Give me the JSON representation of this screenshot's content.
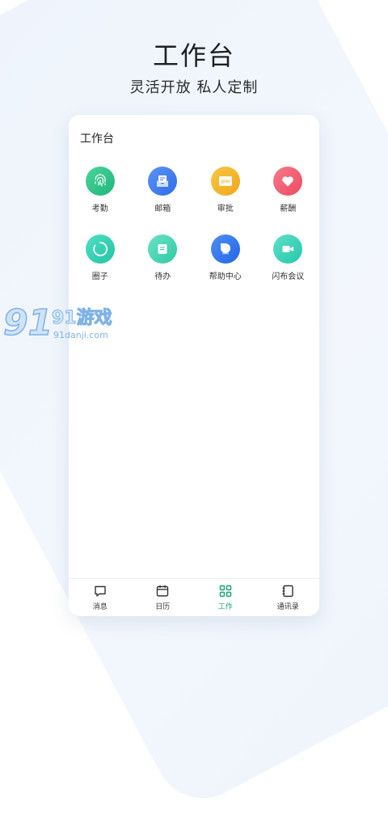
{
  "header": {
    "title": "工作台",
    "subtitle": "灵活开放 私人定制"
  },
  "workbench": {
    "title": "工作台",
    "apps": [
      {
        "label": "考勤",
        "icon": "fingerprint-icon",
        "color": "#2bc48a"
      },
      {
        "label": "邮箱",
        "icon": "mail-icon",
        "color": "#3d7bf0"
      },
      {
        "label": "审批",
        "icon": "approval-bpm-icon",
        "icon_text": "BPM",
        "color": "#f5b526"
      },
      {
        "label": "薪酬",
        "icon": "heart-icon",
        "color": "#f0566c"
      },
      {
        "label": "圈子",
        "icon": "circle-icon",
        "color": "#2ccfb0"
      },
      {
        "label": "待办",
        "icon": "todo-icon",
        "color": "#3fd4b0"
      },
      {
        "label": "帮助中心",
        "icon": "help-icon",
        "color": "#3478f0"
      },
      {
        "label": "闪布会议",
        "icon": "video-icon",
        "color": "#2fcfb6"
      }
    ]
  },
  "tabbar": {
    "items": [
      {
        "label": "消息",
        "icon": "message-icon"
      },
      {
        "label": "日历",
        "icon": "calendar-icon"
      },
      {
        "label": "工作",
        "icon": "grid-icon",
        "active": true,
        "active_color": "#1aa37a"
      },
      {
        "label": "通讯录",
        "icon": "contacts-icon"
      }
    ]
  },
  "watermark": {
    "logo_text": "91游戏",
    "site": "91danji.com"
  }
}
